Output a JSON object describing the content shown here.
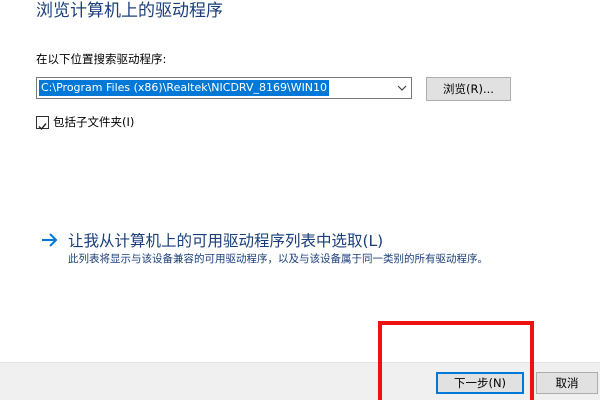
{
  "dialog": {
    "title": "浏览计算机上的驱动程序"
  },
  "search": {
    "label": "在以下位置搜索驱动程序:",
    "path_value": "C:\\Program Files (x86)\\Realtek\\NICDRV_8169\\WIN10",
    "browse_label": "浏览(R)...",
    "include_subfolders_label": "包括子文件夹(I)",
    "include_subfolders_checked": true
  },
  "pick_option": {
    "title": "让我从计算机上的可用驱动程序列表中选取(L)",
    "description": "此列表将显示与该设备兼容的可用驱动程序，以及与该设备属于同一类别的所有驱动程序。",
    "arrow_icon": "arrow-right-icon"
  },
  "footer": {
    "next_label": "下一步(N)",
    "cancel_label": "取消"
  },
  "colors": {
    "accent": "#0078d7",
    "heading_text": "#1a3e7a",
    "highlight": "#ee1111",
    "footer_bg": "#f0f0f0"
  }
}
